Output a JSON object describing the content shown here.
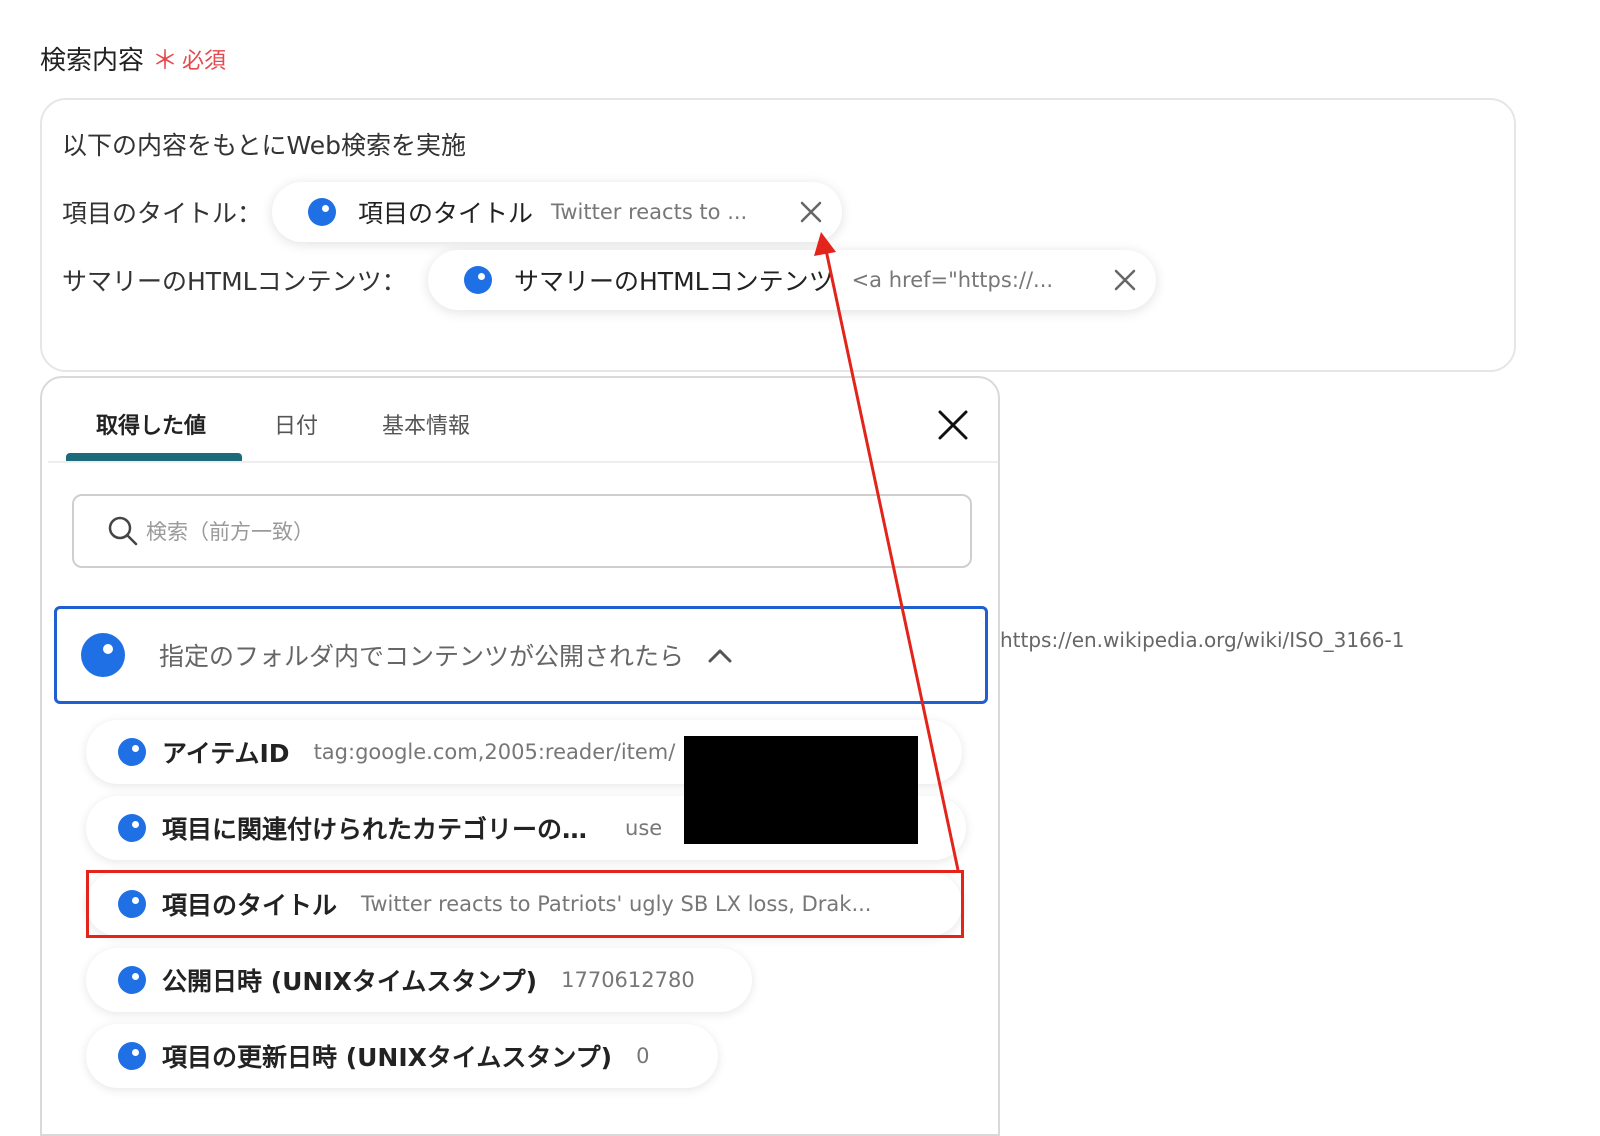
{
  "field": {
    "label": "検索内容",
    "required_star": "＊",
    "required_text": "必須"
  },
  "editor": {
    "line1": "以下の内容をもとにWeb検索を実施",
    "line2_label": "項目のタイトル：",
    "line3_label": "サマリーのHTMLコンテンツ：",
    "chip1": {
      "name": "項目のタイトル",
      "value": "Twitter reacts to ..."
    },
    "chip2": {
      "name": "サマリーのHTMLコンテンツ",
      "value": "<a href=\"https://..."
    }
  },
  "background_url": "https://en.wikipedia.org/wiki/ISO_3166-1",
  "panel": {
    "tabs": [
      {
        "label": "取得した値"
      },
      {
        "label": "日付"
      },
      {
        "label": "基本情報"
      }
    ],
    "search_placeholder": "検索（前方一致）",
    "group_label": "指定のフォルダ内でコンテンツが公開されたら",
    "items": [
      {
        "name": "アイテムID",
        "value": "tag:google.com,2005:reader/item/"
      },
      {
        "name": "項目に関連付けられたカテゴリーの…",
        "value": "use"
      },
      {
        "name": "項目のタイトル",
        "value": "Twitter reacts to Patriots' ugly SB LX loss, Drak..."
      },
      {
        "name": "公開日時 (UNIXタイムスタンプ)",
        "value": "1770612780"
      },
      {
        "name": "項目の更新日時 (UNIXタイムスタンプ)",
        "value": "0"
      }
    ]
  },
  "colors": {
    "accent": "#1f6fe5",
    "required": "#e5484d",
    "annotation": "#e3241b",
    "tab_underline": "#1d6b7a"
  }
}
